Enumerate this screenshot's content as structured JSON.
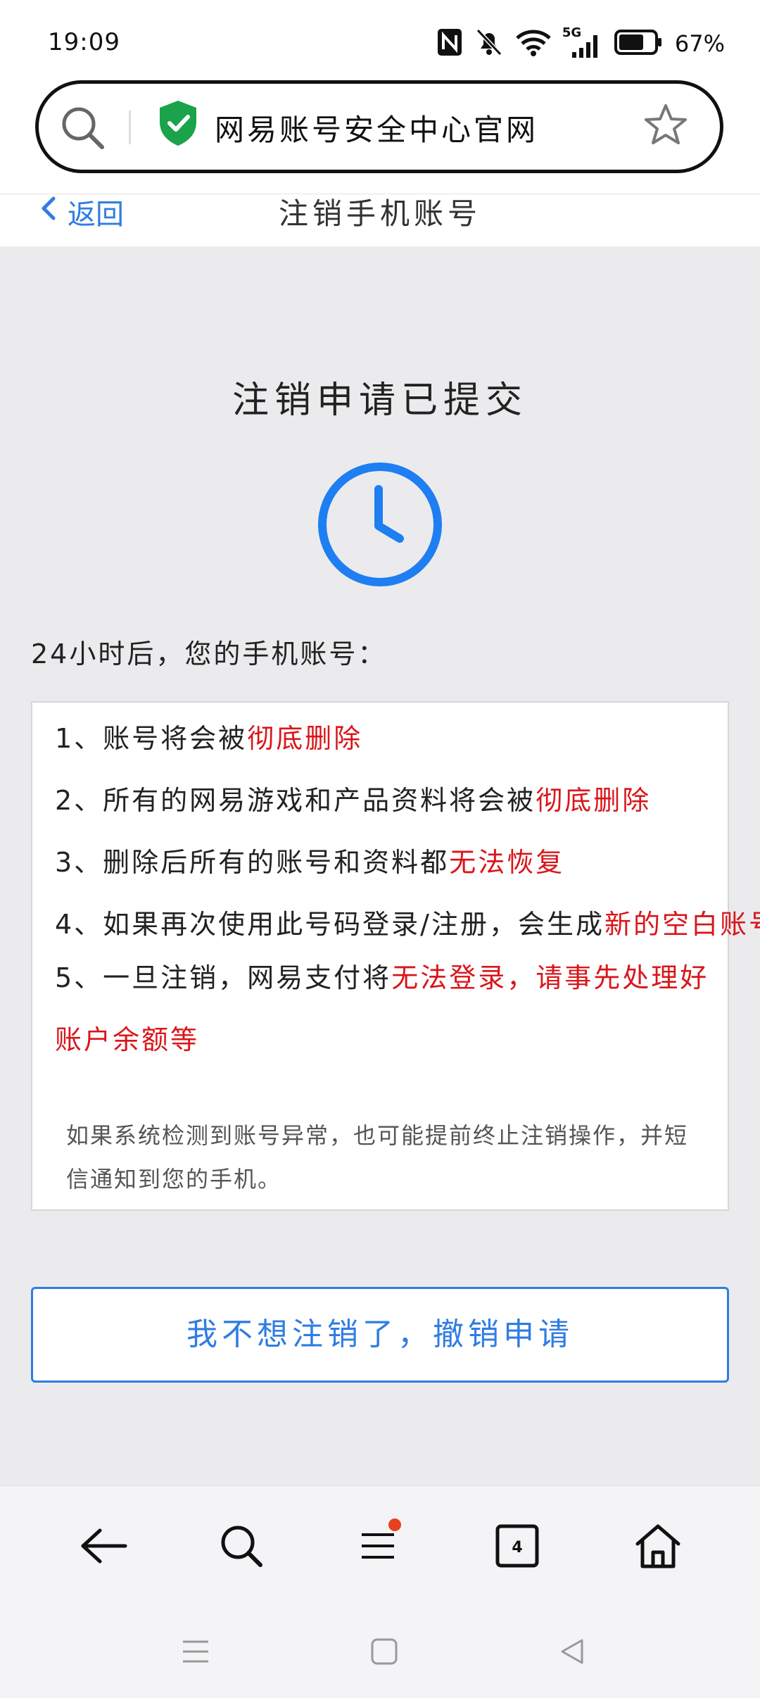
{
  "status_bar": {
    "time": "19:09",
    "battery_percent": "67%",
    "network": "5G",
    "battery_level": 0.67
  },
  "url_bar": {
    "site_title": "网易账号安全中心官网"
  },
  "page_header": {
    "back_label": "返回",
    "title": "注销手机账号"
  },
  "main": {
    "submitted_title": "注销申请已提交",
    "intro": "24小时后，您的手机账号：",
    "items": [
      {
        "prefix": "1、账号将会被",
        "emphasis": "彻底删除",
        "suffix": ""
      },
      {
        "prefix": "2、所有的网易游戏和产品资料将会被",
        "emphasis": "彻底删除",
        "suffix": ""
      },
      {
        "prefix": "3、删除后所有的账号和资料都",
        "emphasis": "无法恢复",
        "suffix": ""
      },
      {
        "prefix": "4、如果再次使用此号码登录/注册，会生成",
        "emphasis": "新的空白账号",
        "suffix": ""
      },
      {
        "prefix": "5、一旦注销，网易支付将",
        "emphasis": "无法登录，请事先处理好账户余额等",
        "suffix": ""
      }
    ],
    "note": "如果系统检测到账号异常，也可能提前终止注销操作，并短信通知到您的手机。",
    "revoke_button": "我不想注销了，撤销申请"
  },
  "toolbar": {
    "tab_count": "4"
  },
  "colors": {
    "accent": "#2f7de1",
    "warning": "#d9161a",
    "shield": "#1aa34a",
    "notification_dot": "#e8411f"
  },
  "icons": [
    "search-icon",
    "shield-check-icon",
    "star-icon",
    "chevron-left-icon",
    "clock-icon",
    "back-arrow-icon",
    "menu-icon",
    "tabs-icon",
    "home-icon"
  ]
}
